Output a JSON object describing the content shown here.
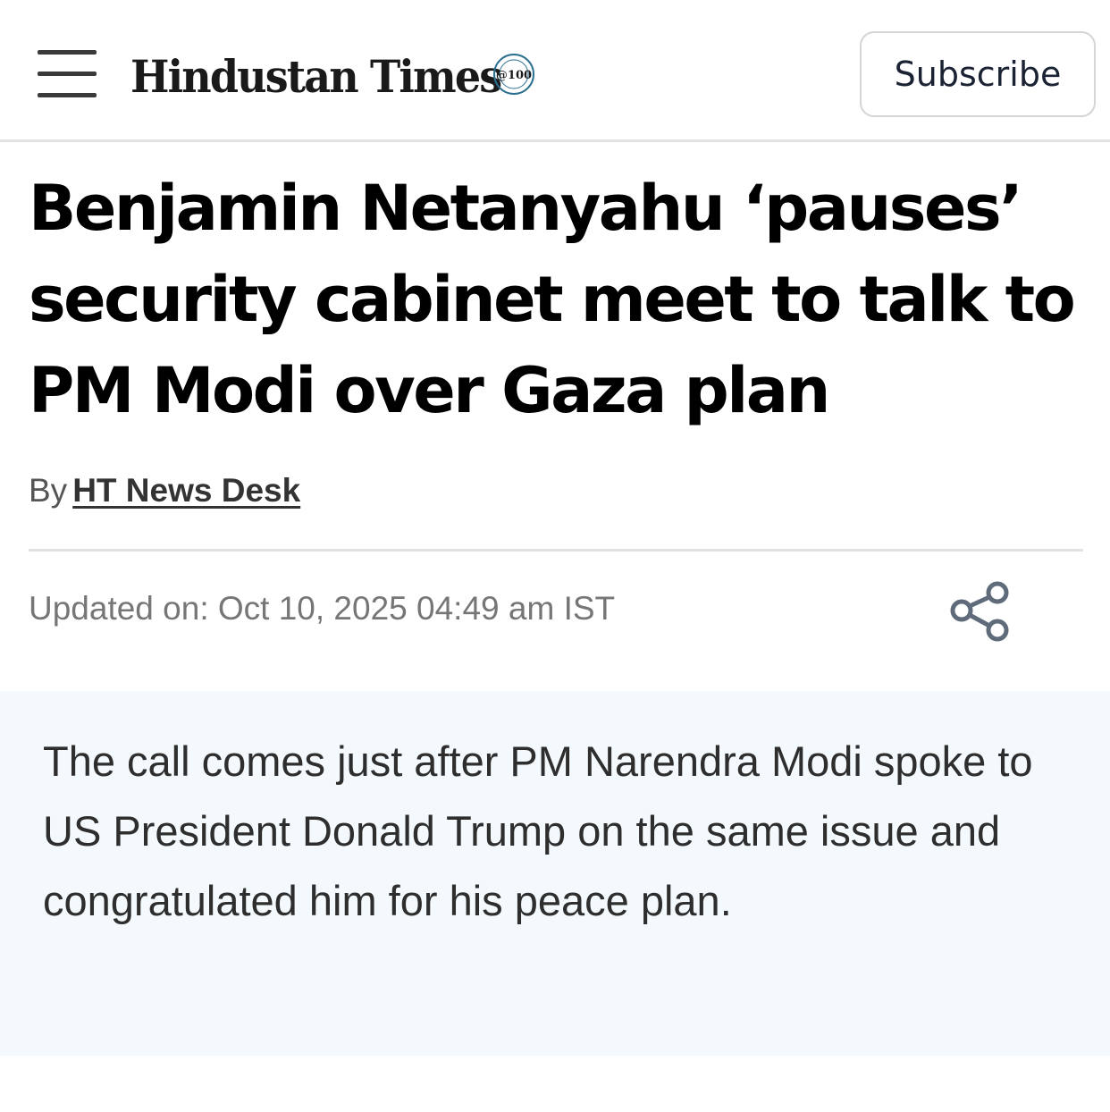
{
  "header": {
    "menu_icon": "hamburger-menu-icon",
    "logo_text": "Hindustan Times",
    "logo_badge_text": "@100",
    "subscribe_label": "Subscribe"
  },
  "article": {
    "headline": "Benjamin Netanyahu ‘pauses’ security cabinet meet to talk to PM Modi over Gaza plan",
    "byline_prefix": "By",
    "author": "HT News Desk",
    "updated": "Updated on: Oct 10, 2025 04:49 am IST",
    "share_icon": "share-icon",
    "summary": "The call comes just after PM Narendra Modi spoke to US President Donald Trump on the same issue and congratulated him for his peace plan."
  },
  "colors": {
    "summary_background": "#f3f9fc",
    "subscribe_text": "#1b2233",
    "share_icon": "#5f6b7a"
  }
}
